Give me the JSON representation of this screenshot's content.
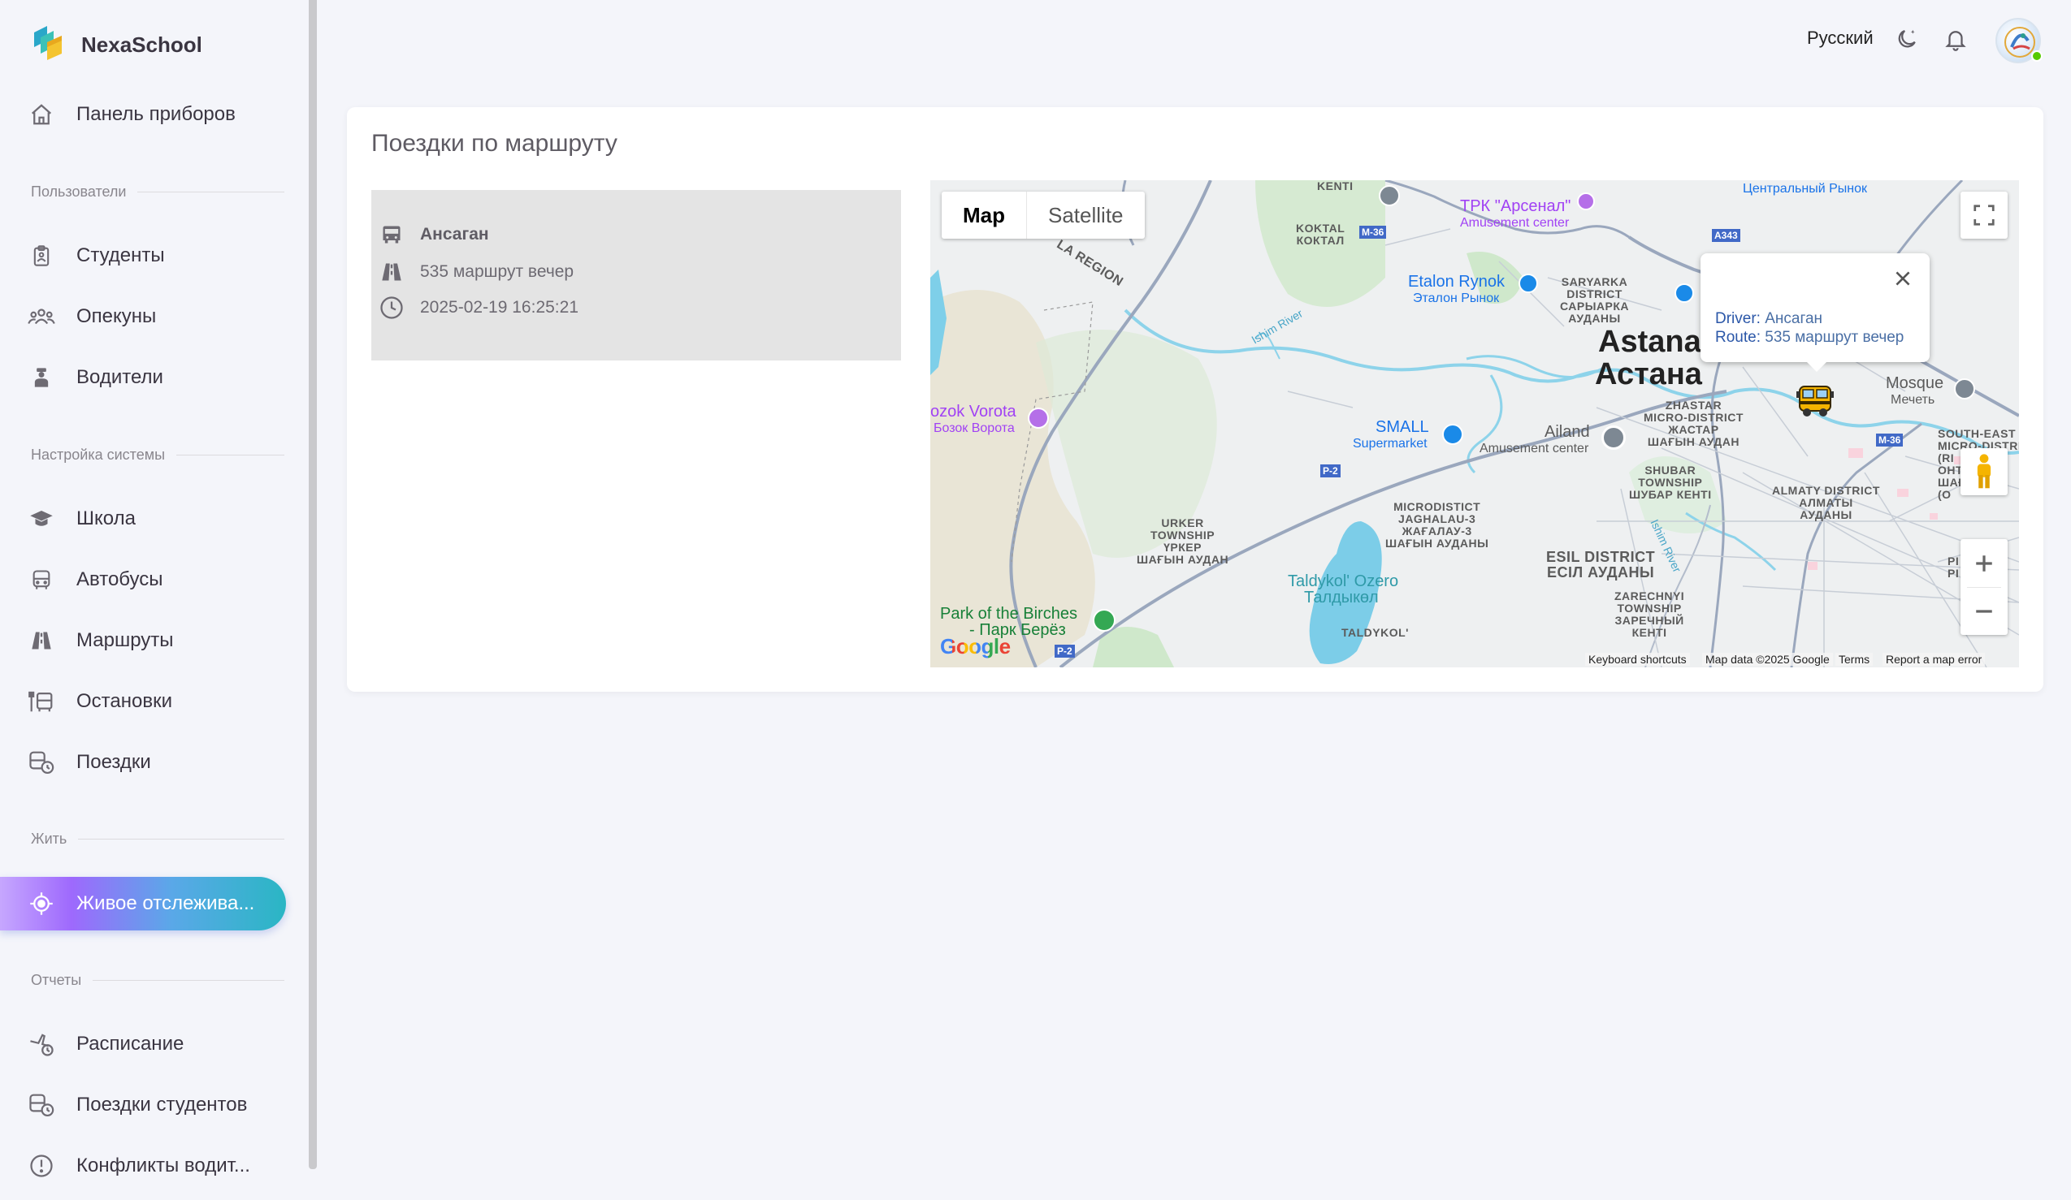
{
  "app": {
    "name": "NexaSchool"
  },
  "header": {
    "language": "Русский"
  },
  "sidebar": {
    "dashboard": "Панель приборов",
    "sections": {
      "users": "Пользователи",
      "settings": "Настройка системы",
      "live": "Жить",
      "reports": "Отчеты"
    },
    "items": {
      "students": "Студенты",
      "guardians": "Опекуны",
      "drivers": "Водители",
      "school": "Школа",
      "buses": "Автобусы",
      "routes": "Маршруты",
      "stops": "Остановки",
      "trips": "Поездки",
      "live_tracking": "Живое отслежива...",
      "schedule": "Расписание",
      "student_trips": "Поездки студентов",
      "driver_conflicts": "Конфликты водит..."
    }
  },
  "page": {
    "title": "Поездки по маршруту",
    "trip": {
      "driver": "Ансаган",
      "route": "535 маршрут вечер",
      "datetime": "2025-02-19 16:25:21"
    }
  },
  "map": {
    "type_buttons": [
      "Map",
      "Satellite"
    ],
    "active_type": "Map",
    "info": {
      "driver_label": "Driver:",
      "driver_value": "Ансаган",
      "route_label": "Route:",
      "route_value": "535 маршрут вечер"
    },
    "labels": {
      "city_en": "Astana",
      "city_ru": "Астана",
      "koktal": "KOKTAL\nКОКТАЛ",
      "kenti": "KENTI",
      "region": "LA REGION",
      "saryarka": "SARYARKA\nDISTRICT\nСАРЫАРКА\nАУДАНЫ",
      "zhastar": "ZHASTAR\nMICRO-DISTRICT\nЖАСТАР\nШАҒЫН АУДАН",
      "shubar": "SHUBAR\nTOWNSHIP\nШУБАР КЕНТІ",
      "almaty": "ALMATY DISTRICT\nАЛМАТЫ\nАУДАНЫ",
      "southeast": "SOUTH-EAST\nMICRO-DISTRIC\n(RI\nОНТҮС\nШАҒ\n(О",
      "microdistict": "MICRODISTICT\nJAGHALAU-3\nЖАҒАЛАУ-3\nШАҒЫН АУДАНЫ",
      "urker": "URKER\nTOWNSHIP\nҮРКЕР\nШАҒЫН АУДАН",
      "esil": "ESIL DISTRICT\nЕСІЛ АУДАНЫ",
      "zarechnyi": "ZARECHNYI\nTOWNSHIP\nЗАРЕЧНЫЙ\nКЕНТІ",
      "taldykol": "TALDYKOL'",
      "ishim1": "Ishim River",
      "ishim2": "Ishim River",
      "pr": "PI\nPI"
    },
    "pois": {
      "arsenal": "ТРК \"Арсенал\"",
      "amusement1": "Amusement center",
      "etalon": "Etalon Rynok",
      "etalon_ru": "Эталон Рынок",
      "central": "Центральный Рынок",
      "bozok": "ozok Vorota",
      "bozok_ru": "Бозок Ворота",
      "small": "SMALL",
      "supermarket": "Supermarket",
      "ailand": "Ailand",
      "amusement2": "Amusement center",
      "mosque": "Mosque",
      "mosque_ru": "Мечеть",
      "lake": "Taldykol' Ozero",
      "lake_ru": "Талдыкөл",
      "park": "Park of the Birches",
      "park_ru": "- Парк Берёз"
    },
    "shields": [
      "M-36",
      "A343",
      "M-36",
      "P-2",
      "P-2"
    ],
    "logo": "Google",
    "footer": [
      "Keyboard shortcuts",
      "Map data ©2025 Google",
      "Terms",
      "Report a map error"
    ]
  }
}
